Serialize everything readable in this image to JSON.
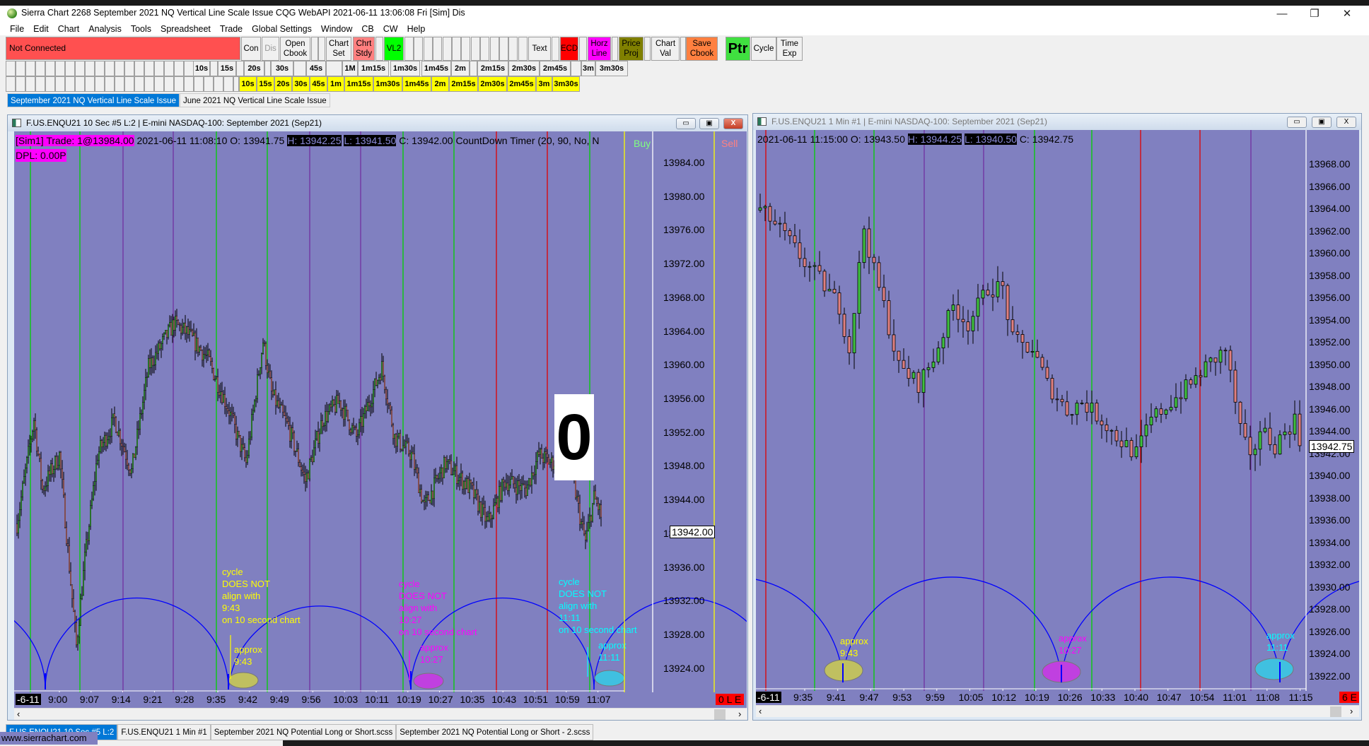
{
  "window": {
    "title": "Sierra Chart 2268 September 2021 NQ Vertical Line Scale Issue  CQG WebAPI 2021-06-11  13:06:08 Fri [Sim]  Dis",
    "controls": [
      "—",
      "❐",
      "✕"
    ]
  },
  "menu": [
    "File",
    "Edit",
    "Chart",
    "Analysis",
    "Tools",
    "Spreadsheet",
    "Trade",
    "Global Settings",
    "Window",
    "CB",
    "CW",
    "Help"
  ],
  "toolbar": {
    "status": "Not Connected",
    "buttons": [
      {
        "label": "Con",
        "color": "#f0f0f0"
      },
      {
        "label": "Dis",
        "color": "#f0f0f0",
        "disabled": true
      },
      {
        "label": "Open\nCbook",
        "color": "#f0f0f0"
      },
      {
        "label": "Chart\nSet",
        "color": "#f0f0f0"
      },
      {
        "label": "Chrt\nStdy",
        "color": "#ff8080"
      },
      {
        "label": "VL2",
        "color": "#00ff00"
      },
      {
        "label": "Text",
        "color": "#f0f0f0"
      },
      {
        "label": "ECD",
        "color": "#ff0000"
      },
      {
        "label": "Horz\nLine",
        "color": "#ff00ff"
      },
      {
        "label": "Price\nProj",
        "color": "#808000"
      },
      {
        "label": "Chart\nVal",
        "color": "#f0f0f0"
      },
      {
        "label": "Save\nCbook",
        "color": "#ff8040"
      },
      {
        "label": "Ptr",
        "color": "#40e040"
      },
      {
        "label": "Cycle",
        "color": "#f0f0f0"
      },
      {
        "label": "Time\nExp",
        "color": "#f0f0f0"
      }
    ],
    "row2": [
      "10s",
      "15s",
      "20s",
      "30s",
      "45s",
      "1M",
      "1m15s",
      "1m30s",
      "1m45s",
      "2m",
      "2m15s",
      "2m30s",
      "2m45s",
      "3m",
      "3m30s"
    ],
    "row3": [
      "10s",
      "15s",
      "20s",
      "30s",
      "45s",
      "1m",
      "1m15s",
      "1m30s",
      "1m45s",
      "2m",
      "2m15s",
      "2m30s",
      "2m45s",
      "3m",
      "3m30s"
    ],
    "row3_color": "#ffff00"
  },
  "chartbook_tabs": [
    {
      "label": "September 2021 NQ Vertical Line Scale Issue",
      "active": true
    },
    {
      "label": "June 2021 NQ Vertical Line Scale Issue",
      "active": false
    }
  ],
  "left_chart": {
    "title": "F.US.ENQU21  10 Sec   #5 L:2 | E-mini NASDAQ-100: September 2021 (Sep21)",
    "header": {
      "sim_trade": "[Sim1]  Trade: 1@13984.00",
      "datetime": "2021-06-11 11:08:10",
      "open": "O: 13941.75",
      "high": "H: 13942.25",
      "low": "L: 13941.50",
      "close": "C: 13942.00",
      "study": "CountDown Timer    (20, 90, No, N",
      "dpl": "DPL: 0.00P",
      "buy": "Buy",
      "sell": "Sell"
    },
    "countdown": "0",
    "price_labels": [
      "13984.00",
      "13980.00",
      "13976.00",
      "13972.00",
      "13968.00",
      "13964.00",
      "13960.00",
      "13956.00",
      "13952.00",
      "13948.00",
      "13944.00",
      "13940.00",
      "13936.00",
      "13932.00",
      "13928.00",
      "13924.00"
    ],
    "current_price": "13942.00",
    "time_labels": [
      "9:00",
      "9:07",
      "9:14",
      "9:21",
      "9:28",
      "9:35",
      "9:42",
      "9:49",
      "9:56",
      "10:03",
      "10:11",
      "10:19",
      "10:27",
      "10:35",
      "10:43",
      "10:51",
      "10:59",
      "11:07"
    ],
    "date_label": "-6-11",
    "status_box": "0 L E",
    "price_path": [
      [
        "8:50",
        13941.2
      ],
      [
        "8:54",
        13953.6
      ],
      [
        "8:56",
        13945.3
      ],
      [
        "9:00",
        13949.4
      ],
      [
        "9:04",
        13926.7
      ],
      [
        "9:06",
        13937.0
      ],
      [
        "9:09",
        13949.4
      ],
      [
        "9:13",
        13953.6
      ],
      [
        "9:17",
        13947.4
      ],
      [
        "9:21",
        13959.8
      ],
      [
        "9:27",
        13965.0
      ],
      [
        "9:30",
        13963.9
      ],
      [
        "9:35",
        13960.8
      ],
      [
        "9:40",
        13954.6
      ],
      [
        "9:44",
        13948.4
      ],
      [
        "9:48",
        13962.9
      ],
      [
        "9:50",
        13956.7
      ],
      [
        "9:54",
        13952.6
      ],
      [
        "9:58",
        13946.3
      ],
      [
        "10:02",
        13953.6
      ],
      [
        "10:06",
        13955.7
      ],
      [
        "10:10",
        13951.5
      ],
      [
        "10:16",
        13959.8
      ],
      [
        "10:19",
        13951.5
      ],
      [
        "10:23",
        13949.4
      ],
      [
        "10:26",
        13943.2
      ],
      [
        "10:31",
        13948.4
      ],
      [
        "10:37",
        13945.3
      ],
      [
        "10:41",
        13941.2
      ],
      [
        "10:45",
        13946.3
      ],
      [
        "10:50",
        13945.3
      ],
      [
        "10:53",
        13949.4
      ],
      [
        "10:56",
        13948.4
      ],
      [
        "11:00",
        13949.4
      ],
      [
        "11:03",
        13941.2
      ],
      [
        "11:04",
        13939.1
      ],
      [
        "11:06",
        13944.3
      ],
      [
        "11:08",
        13942.0
      ]
    ],
    "annotations": [
      {
        "lines": [
          "cycle",
          "DOES NOT",
          "align with",
          "9:43",
          "on 10 second chart"
        ],
        "approx": [
          "approx",
          "9:43"
        ],
        "color": "#ffff00",
        "marker": "#c0c060"
      },
      {
        "lines": [
          "cycle",
          "DOES NOT",
          "align with",
          "10:27",
          "on 10 second chart"
        ],
        "approx": [
          "approx",
          "10:27"
        ],
        "color": "#ff00ff",
        "marker": "#c040e0"
      },
      {
        "lines": [
          "cycle",
          "DOES NOT",
          "align with",
          "11:11",
          "on 10 second chart"
        ],
        "approx": [
          "approx",
          "11:11"
        ],
        "color": "#00ffff",
        "marker": "#40c0e0"
      }
    ]
  },
  "right_chart": {
    "title": "F.US.ENQU21  1 Min   #1 | E-mini NASDAQ-100: September 2021 (Sep21)",
    "header": {
      "datetime": "2021-06-11 11:15:00",
      "open": "O: 13943.50",
      "high": "H: 13944.25",
      "low": "L: 13940.50",
      "close": "C: 13942.75"
    },
    "price_labels": [
      "13968.00",
      "13966.00",
      "13964.00",
      "13962.00",
      "13960.00",
      "13958.00",
      "13956.00",
      "13954.00",
      "13952.00",
      "13950.00",
      "13948.00",
      "13946.00",
      "13944.00",
      "13942.00",
      "13940.00",
      "13938.00",
      "13936.00",
      "13934.00",
      "13932.00",
      "13930.00",
      "13928.00",
      "13926.00",
      "13924.00",
      "13922.00"
    ],
    "current_price": "13942.75",
    "time_labels": [
      "9:35",
      "9:41",
      "9:47",
      "9:53",
      "9:59",
      "10:05",
      "10:12",
      "10:19",
      "10:26",
      "10:33",
      "10:40",
      "10:47",
      "10:54",
      "11:01",
      "11:08",
      "11:15"
    ],
    "date_label": "-6-11",
    "status_box": "6 E",
    "price_path": [
      [
        "9:26",
        13963.9
      ],
      [
        "9:28",
        13963.1
      ],
      [
        "9:31",
        13961.6
      ],
      [
        "9:35",
        13959.2
      ],
      [
        "9:38",
        13957.7
      ],
      [
        "9:42",
        13955.3
      ],
      [
        "9:44",
        13951.4
      ],
      [
        "9:47",
        13962.4
      ],
      [
        "9:49",
        13958.4
      ],
      [
        "9:51",
        13955.3
      ],
      [
        "9:54",
        13949.8
      ],
      [
        "9:58",
        13948.3
      ],
      [
        "10:01",
        13950.6
      ],
      [
        "10:05",
        13955.3
      ],
      [
        "10:08",
        13953.7
      ],
      [
        "10:12",
        13956.9
      ],
      [
        "10:15",
        13956.9
      ],
      [
        "10:17",
        13952.2
      ],
      [
        "10:21",
        13951.4
      ],
      [
        "10:24",
        13948.3
      ],
      [
        "10:28",
        13945.9
      ],
      [
        "10:31",
        13946.7
      ],
      [
        "10:35",
        13945.1
      ],
      [
        "10:38",
        13943.5
      ],
      [
        "10:42",
        13942.0
      ],
      [
        "10:45",
        13945.1
      ],
      [
        "10:49",
        13946.7
      ],
      [
        "10:53",
        13948.3
      ],
      [
        "10:56",
        13949.8
      ],
      [
        "11:00",
        13951.4
      ],
      [
        "11:03",
        13944.3
      ],
      [
        "11:05",
        13941.2
      ],
      [
        "11:07",
        13944.3
      ],
      [
        "11:10",
        13942.8
      ],
      [
        "11:14",
        13945.1
      ],
      [
        "11:15",
        13942.75
      ]
    ],
    "annotations": [
      {
        "approx": [
          "approx",
          "9:43"
        ],
        "color": "#ffff00",
        "marker": "#c0c060"
      },
      {
        "approx": [
          "approx",
          "10:27"
        ],
        "color": "#ff00ff",
        "marker": "#c040e0"
      },
      {
        "approx": [
          "approx",
          "11:11"
        ],
        "color": "#00ffff",
        "marker": "#40c0e0"
      }
    ]
  },
  "bottom_tabs": [
    {
      "label": "F.US.ENQU21  10 Sec   #5 L:2",
      "active": true
    },
    {
      "label": "F.US.ENQU21  1 Min   #1",
      "active": false
    },
    {
      "label": "September 2021 NQ Potential Long or Short.scss",
      "active": false
    },
    {
      "label": "September 2021 NQ Potential Long or Short - 2.scss",
      "active": false
    }
  ],
  "watermark": "www.sierrachart.com",
  "colors": {
    "chart_bg": "#8080c0",
    "up_candle": "#40c040",
    "down_candle": "#e08080",
    "cycle_arc": "#0000ff",
    "status_red": "#ff5050"
  }
}
